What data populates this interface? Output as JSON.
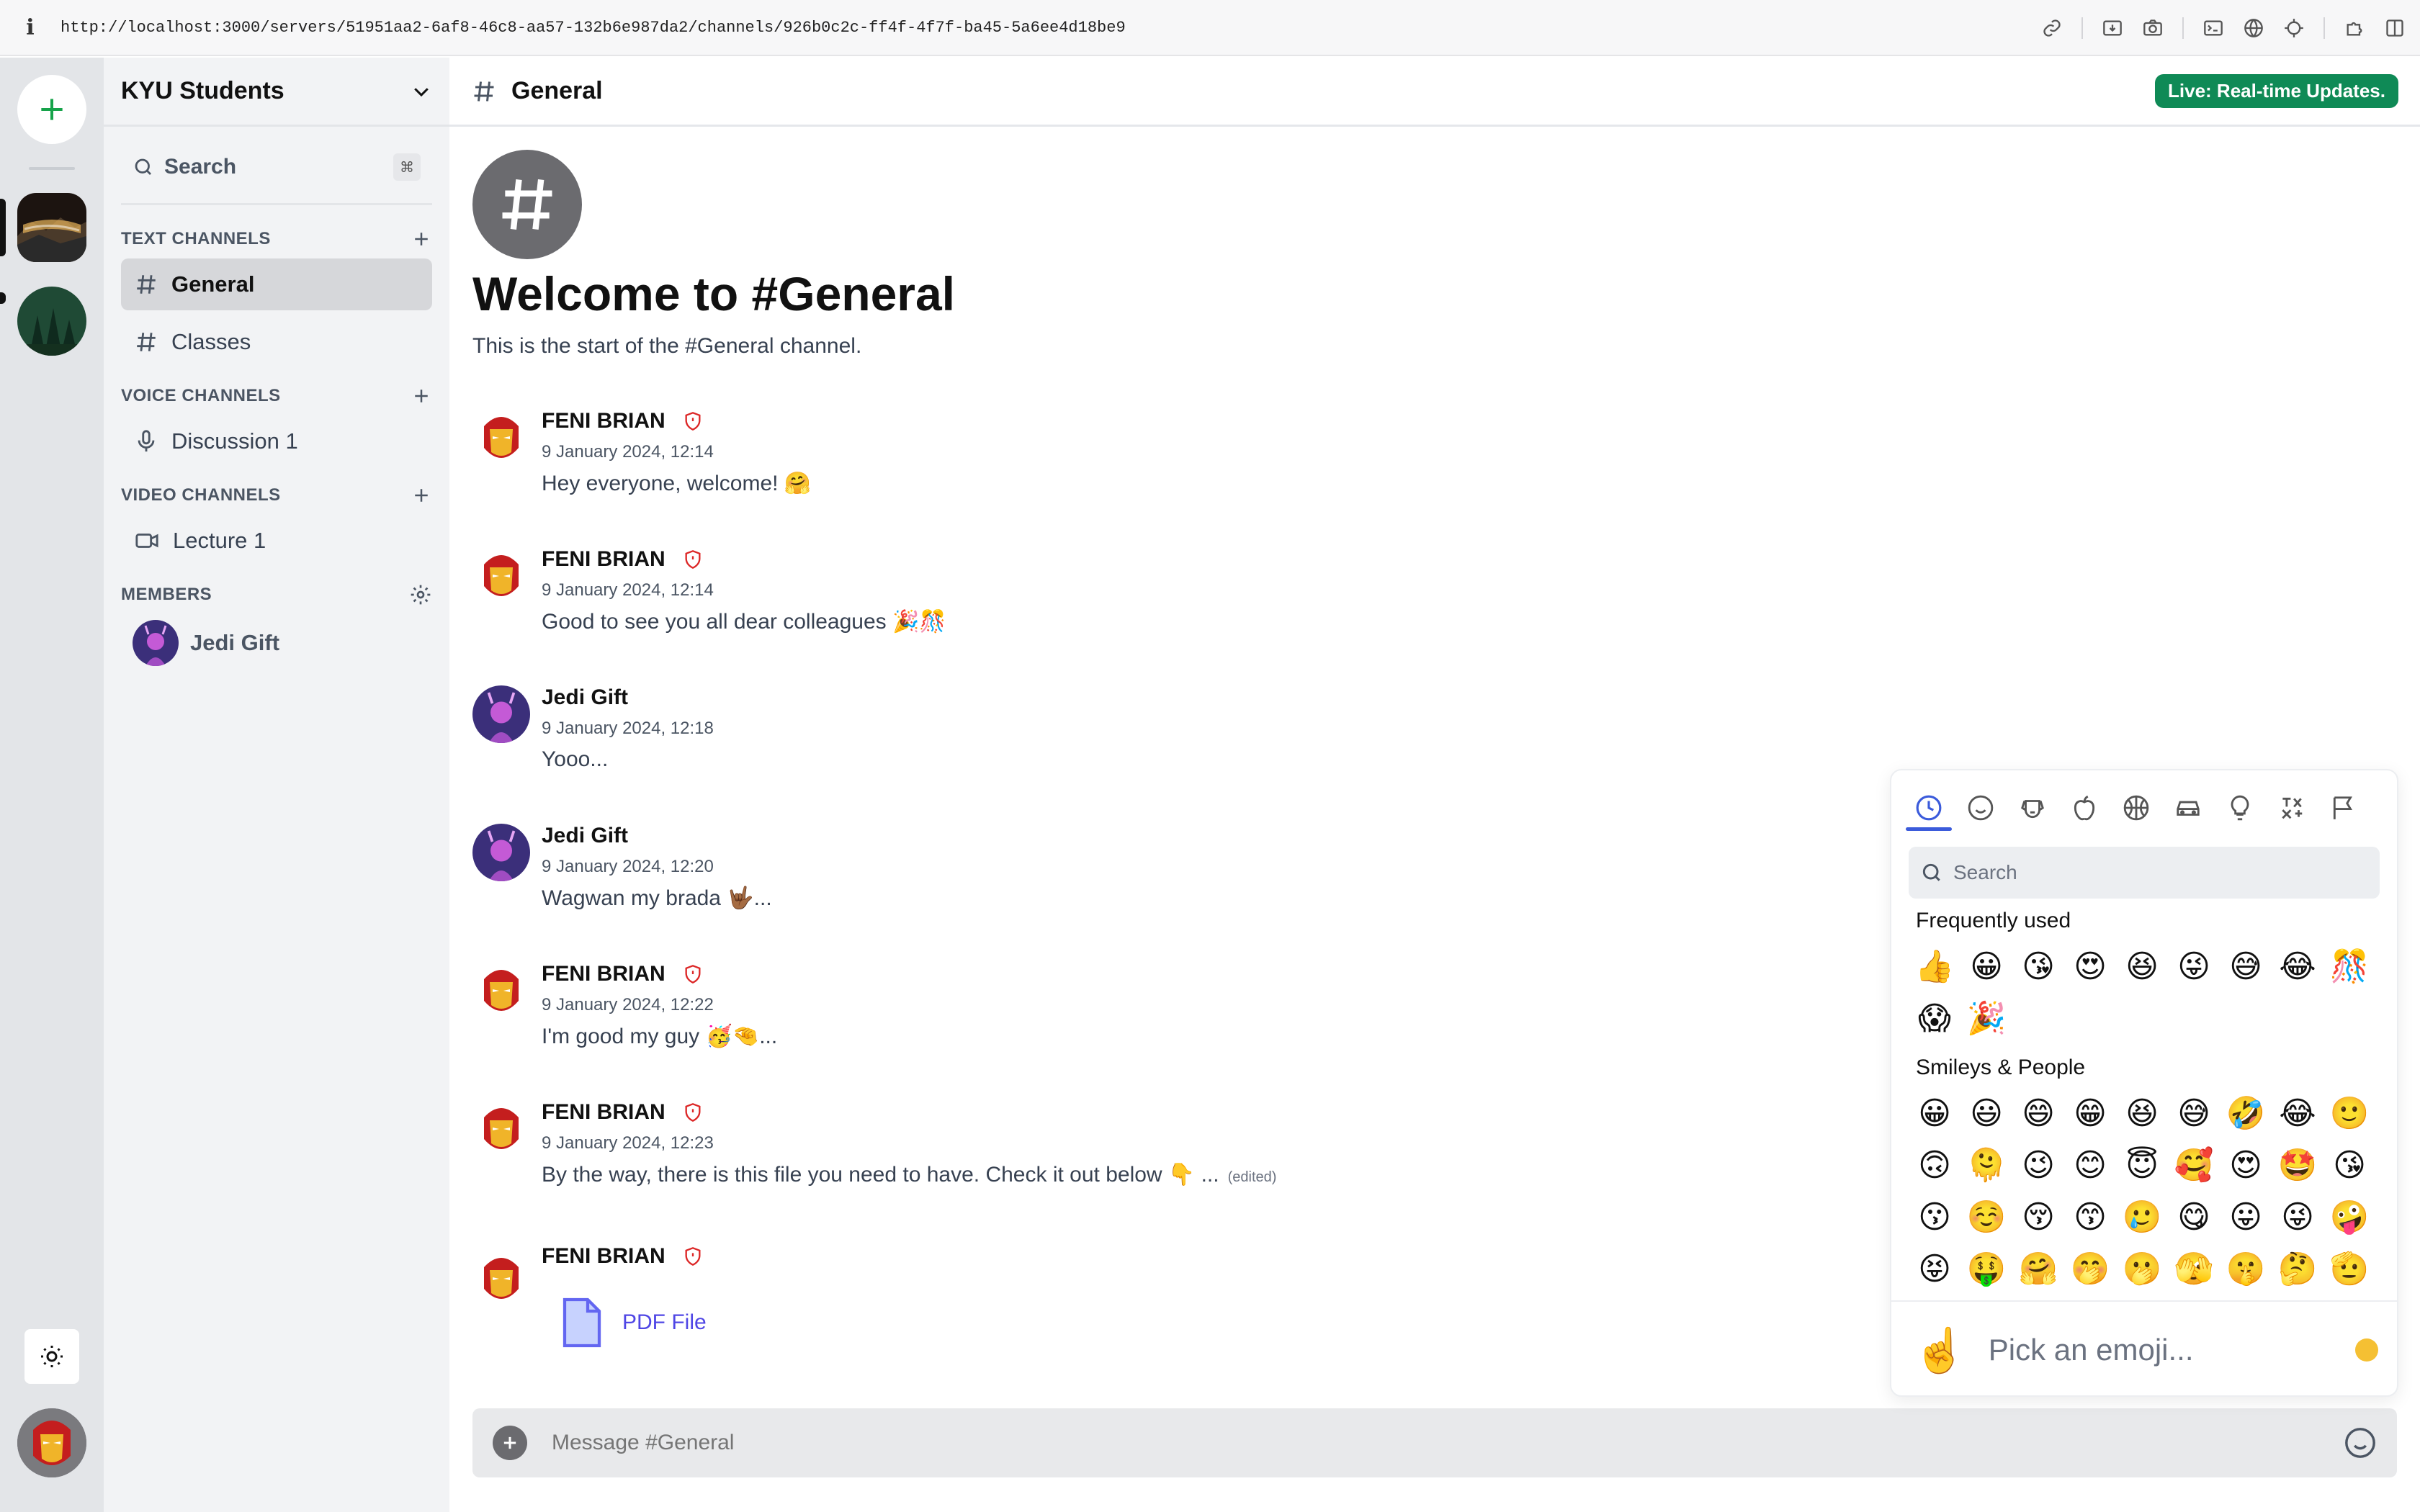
{
  "browser": {
    "info_glyph": "i",
    "url": "http://localhost:3000/servers/51951aa2-6af8-46c8-aa57-132b6e987da2/channels/926b0c2c-ff4f-4f7f-ba45-5a6ee4d18be9",
    "tools": [
      "link-icon",
      "download-icon",
      "camera-icon",
      "terminal-icon",
      "globe-icon",
      "crosshair-icon",
      "extensions-icon",
      "sidebar-icon"
    ]
  },
  "rail": {
    "add_glyph": "+",
    "servers": [
      "server-mountain",
      "server-forest"
    ]
  },
  "sidebar": {
    "server_name": "KYU Students",
    "search_label": "Search",
    "search_kbd": "⌘",
    "sections": {
      "text": "TEXT CHANNELS",
      "voice": "VOICE CHANNELS",
      "video": "VIDEO CHANNELS",
      "members": "MEMBERS"
    },
    "text_channels": [
      "General",
      "Classes"
    ],
    "voice_channels": [
      "Discussion 1"
    ],
    "video_channels": [
      "Lecture 1"
    ],
    "members": [
      "Jedi Gift"
    ]
  },
  "header": {
    "channel": "General",
    "live_badge": "Live: Real-time Updates."
  },
  "welcome": {
    "title": "Welcome to #General",
    "subtitle": "This is the start of the #General channel."
  },
  "messages": [
    {
      "author": "FENI BRIAN",
      "time": "9 January 2024, 12:14",
      "text": "Hey everyone, welcome! 🤗"
    },
    {
      "author": "FENI BRIAN",
      "time": "9 January 2024, 12:14",
      "text": "Good to see you all dear colleagues 🎉🎊"
    },
    {
      "author": "Jedi Gift",
      "time": "9 January 2024, 12:18",
      "text": "Yooo..."
    },
    {
      "author": "Jedi Gift",
      "time": "9 January 2024, 12:20",
      "text": "Wagwan my brada 🤟🏾..."
    },
    {
      "author": "FENI BRIAN",
      "time": "9 January 2024, 12:22",
      "text": "I'm good my guy 🥳🤏..."
    },
    {
      "author": "FENI BRIAN",
      "time": "9 January 2024, 12:23",
      "text": "By the way, there is this file you need to have. Check it out below 👇 ...",
      "edited": "(edited)"
    },
    {
      "author": "FENI BRIAN",
      "attachment": "PDF File"
    }
  ],
  "composer": {
    "placeholder": "Message #General"
  },
  "emoji_picker": {
    "search_placeholder": "Search",
    "frequent_label": "Frequently used",
    "frequent": [
      "👍",
      "😀",
      "😘",
      "😍",
      "😆",
      "😜",
      "😅",
      "😂",
      "🎊",
      "😱",
      "🎉"
    ],
    "people_label": "Smileys & People",
    "people": [
      "😀",
      "😃",
      "😄",
      "😁",
      "😆",
      "😅",
      "🤣",
      "😂",
      "🙂",
      "🙃",
      "🫠",
      "😉",
      "😊",
      "😇",
      "🥰",
      "😍",
      "🤩",
      "😘",
      "😗",
      "☺️",
      "😚",
      "😙",
      "🥲",
      "😋",
      "😛",
      "😜",
      "🤪",
      "😝",
      "🤑",
      "🤗",
      "🤭",
      "🫢",
      "🫣",
      "🤫",
      "🤔",
      "🫡"
    ],
    "footer_placeholder": "Pick an emoji...",
    "footer_emoji": "☝️",
    "skin_tone_color": "#f5c033"
  },
  "colors": {
    "accent_green": "#0f8a56",
    "link_blue": "#4f46e5",
    "admin_red": "#dc2626"
  }
}
